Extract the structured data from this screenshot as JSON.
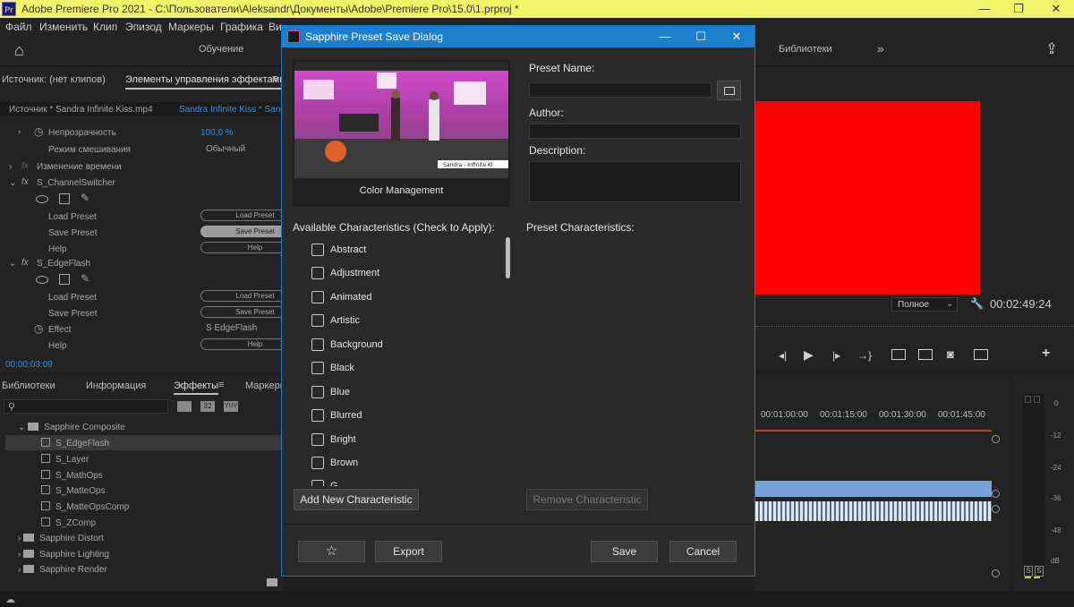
{
  "window": {
    "title": "Adobe Premiere Pro 2021 - C:\\Пользователи\\Aleksandr\\Документы\\Adobe\\Premiere Pro\\15.0\\1.prproj *",
    "app_icon": "Pr",
    "min": "—",
    "max": "❐",
    "close": "✕"
  },
  "menu": [
    "Файл",
    "Изменить",
    "Клип",
    "Эпизод",
    "Маркеры",
    "Графика",
    "Ви"
  ],
  "workspace": {
    "home_icon": "⌂",
    "learning": "Обучение",
    "libraries": "Библиотеки",
    "more": "»",
    "share_icon": "⇪"
  },
  "source_panel": {
    "tab_source": "Источник: (нет клипов)",
    "tab_effects_controls": "Элементы управления эффектами",
    "menu_icon": "≡",
    "clip_path": "Источник * Sandra  Infinite Kiss.mp4",
    "clip_seq": "Sandra  Infinite Kiss * Sand",
    "opacity_label": "Непрозрачность",
    "opacity_value": "100,0 %",
    "blend_label": "Режим смешивания",
    "blend_value": "Обычный",
    "time_remap": "Изменение времени",
    "fx_channel": "S_ChannelSwitcher",
    "load_preset": "Load Preset",
    "save_preset": "Save Preset",
    "help": "Help",
    "fx_edge": "S_EdgeFlash",
    "load_preset_2": "Load Preset",
    "save_preset_2": "Save Preset",
    "effect_label": "Effect",
    "effect_value": "S EdgeFlash",
    "help_2": "Help",
    "btn_load": "Load Preset",
    "btn_save": "Save Preset",
    "btn_help": "Help",
    "btn_load_2": "Load Preset",
    "btn_save_2": "Save Preset",
    "btn_help_2": "Help",
    "timecode": "00:00:03:09"
  },
  "effects_panel": {
    "tab_libraries": "Библиотеки",
    "tab_info": "Информация",
    "tab_effects": "Эффекты",
    "tab_markers": "Маркеры",
    "menu_icon": "≡",
    "search_icon": "⚲",
    "tree": [
      {
        "label": "Sapphire Composite",
        "type": "folder",
        "expanded": true
      },
      {
        "label": "S_EdgeFlash",
        "type": "preset",
        "selected": true
      },
      {
        "label": "S_Layer",
        "type": "preset"
      },
      {
        "label": "S_MathOps",
        "type": "preset"
      },
      {
        "label": "S_MatteOps",
        "type": "preset"
      },
      {
        "label": "S_MatteOpsComp",
        "type": "preset"
      },
      {
        "label": "S_ZComp",
        "type": "preset"
      },
      {
        "label": "Sapphire Distort",
        "type": "folder"
      },
      {
        "label": "Sapphire Lighting",
        "type": "folder"
      },
      {
        "label": "Sapphire Render",
        "type": "folder"
      }
    ]
  },
  "dialog": {
    "title": "Sapphire Preset Save Dialog",
    "min": "—",
    "max": "☐",
    "close": "✕",
    "preview_caption": "Color Management",
    "preview_overlay": "Sandra - Infinite Ki",
    "preset_name_label": "Preset Name:",
    "preset_name_value": "",
    "author_label": "Author:",
    "author_value": "",
    "description_label": "Description:",
    "description_value": "",
    "available_label": "Available Characteristics (Check to Apply):",
    "preset_char_label": "Preset Characteristics:",
    "characteristics": [
      "Abstract",
      "Adjustment",
      "Animated",
      "Artistic",
      "Background",
      "Black",
      "Blue",
      "Blurred",
      "Bright",
      "Brown",
      "G"
    ],
    "add_button": "Add New Characteristic",
    "remove_button": "Remove Characteristic",
    "star_icon": "☆",
    "export_button": "Export",
    "save_button": "Save",
    "cancel_button": "Cancel"
  },
  "program": {
    "fit": "Полное",
    "timecode": "00:02:49:24",
    "wrench_icon": "🔧",
    "add_icon": "+"
  },
  "timeline": {
    "times": [
      "00:01:00:00",
      "00:01:15:00",
      "00:01:30:00",
      "00:01:45:00"
    ]
  },
  "meter": {
    "labels": [
      "0",
      "-12",
      "-24",
      "-36",
      "-48",
      "dB"
    ],
    "solo": [
      "S",
      "S"
    ]
  },
  "colors": {
    "titlebar": "#f3f36a",
    "dialog_titlebar": "#1c7fd0",
    "program_fill": "#ff0000",
    "accent_blue": "#3b8fd9"
  }
}
